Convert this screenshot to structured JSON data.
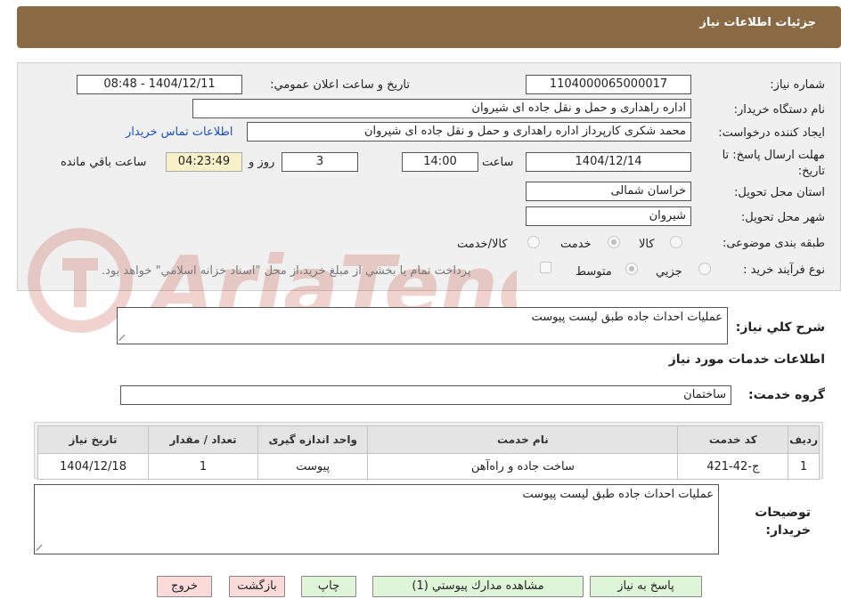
{
  "header": {
    "title": "جزئيات اطلاعات نياز"
  },
  "info": {
    "need_number": {
      "label": "شماره نياز:",
      "value": "1104000065000017"
    },
    "announce_datetime": {
      "label": "تاريخ و ساعت اعلان عمومي:",
      "value": "1404/12/11 - 08:48"
    },
    "buyer_org": {
      "label": "نام دستگاه خريدار:",
      "value": "اداره راهداری و حمل و نقل جاده ای شیروان"
    },
    "requester": {
      "label": "ايجاد كننده درخواست:",
      "value": "محمد شکری کارپرداز اداره راهداری و حمل و نقل جاده ای شیروان",
      "contact_link": "اطلاعات تماس خريدار"
    },
    "deadline": {
      "label": "مهلت ارسال پاسخ: تا تاريخ:",
      "date": "1404/12/14",
      "time_label": "ساعت",
      "time": "14:00",
      "days": "3",
      "days_label": "روز و",
      "remaining": "04:23:49",
      "remaining_label": "ساعت باقي مانده"
    },
    "province": {
      "label": "استان محل تحويل:",
      "value": "خراسان شمالی"
    },
    "city": {
      "label": "شهر محل تحويل:",
      "value": "شیروان"
    },
    "category": {
      "label": "طبقه بندی موضوعی:",
      "options": [
        "كالا",
        "خدمت",
        "كالا/خدمت"
      ],
      "selected": "خدمت"
    },
    "process_type": {
      "label": "نوع فرآيند خريد :",
      "options": [
        "جزيي",
        "متوسط"
      ],
      "selected": "متوسط",
      "payment_note": "پرداخت تمام يا بخشي از مبلغ خريد،از محل \"اسناد خزانه اسلامي\" خواهد بود."
    }
  },
  "summary": {
    "label": "شرح كلي نياز:",
    "value": "عملیات احداث جاده طبق لیست پیوست"
  },
  "services_section": {
    "title": "اطلاعات خدمات مورد نياز"
  },
  "service_group": {
    "label": "گروه خدمت:",
    "value": "ساختمان"
  },
  "services_table": {
    "headers": [
      "رديف",
      "كد خدمت",
      "نام خدمت",
      "واحد اندازه گيری",
      "تعداد / مقدار",
      "تاريخ نياز"
    ],
    "rows": [
      [
        "1",
        "ج-42-421",
        "ساخت جاده و راه‌آهن",
        "پیوست",
        "1",
        "1404/12/18"
      ]
    ]
  },
  "buyer_notes": {
    "label": "توضيحات خريدار:",
    "value": "عملیات احداث جاده طبق لیست پیوست"
  },
  "buttons": {
    "reply": "پاسخ به نياز",
    "attachments": "مشاهده مدارك پيوستي (1)",
    "print": "چاپ",
    "back": "بازگشت",
    "exit": "خروج"
  },
  "colors": {
    "header_bg": "#8a6a45",
    "green_button": "#dff5d8",
    "red_button": "#fbdada",
    "link": "#1a4fc4"
  }
}
